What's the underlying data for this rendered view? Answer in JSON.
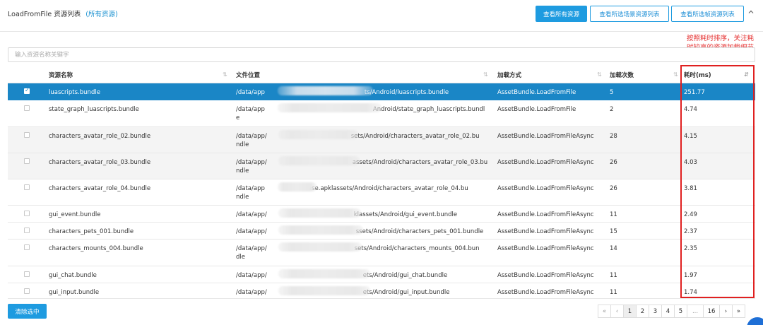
{
  "header": {
    "title": "LoadFromFile 资源列表",
    "title_link": "(所有资源)",
    "btn_all": "查看所有资源",
    "btn_scene": "查看所选场景资源列表",
    "btn_frame": "查看所选帧资源列表"
  },
  "search": {
    "placeholder": "输入资源名称关键字"
  },
  "columns": {
    "name": "资源名称",
    "path": "文件位置",
    "method": "加载方式",
    "count": "加载次数",
    "time": "耗时(ms)"
  },
  "rows": [
    {
      "name": "luascripts.bundle",
      "path_prefix": "/data/app",
      "path_suffix": "ts/Android/luascripts.bundle",
      "path_line2": "",
      "method": "AssetBundle.LoadFromFile",
      "count": "5",
      "time": "251.77"
    },
    {
      "name": "state_graph_luascripts.bundle",
      "path_prefix": "/data/app",
      "path_suffix": "Android/state_graph_luascripts.bundl",
      "path_line2": "e",
      "method": "AssetBundle.LoadFromFile",
      "count": "2",
      "time": "4.74"
    },
    {
      "name": "characters_avatar_role_02.bundle",
      "path_prefix": "/data/app/",
      "path_suffix": "sets/Android/characters_avatar_role_02.bu",
      "path_line2": "ndle",
      "method": "AssetBundle.LoadFromFileAsync",
      "count": "28",
      "time": "4.15"
    },
    {
      "name": "characters_avatar_role_03.bundle",
      "path_prefix": "/data/app/",
      "path_suffix": "assets/Android/characters_avatar_role_03.bu",
      "path_line2": "ndle",
      "method": "AssetBundle.LoadFromFileAsync",
      "count": "26",
      "time": "4.03"
    },
    {
      "name": "characters_avatar_role_04.bundle",
      "path_prefix": "/data/app",
      "path_suffix": "ase.apklassets/Android/characters_avatar_role_04.bu",
      "path_line2": "ndle",
      "method": "AssetBundle.LoadFromFileAsync",
      "count": "26",
      "time": "3.81"
    },
    {
      "name": "gui_event.bundle",
      "path_prefix": "/data/app/",
      "path_suffix": "klassets/Android/gui_event.bundle",
      "path_line2": "",
      "method": "AssetBundle.LoadFromFileAsync",
      "count": "11",
      "time": "2.49"
    },
    {
      "name": "characters_pets_001.bundle",
      "path_prefix": "/data/app/",
      "path_suffix": "ssets/Android/characters_pets_001.bundle",
      "path_line2": "",
      "method": "AssetBundle.LoadFromFileAsync",
      "count": "15",
      "time": "2.37"
    },
    {
      "name": "characters_mounts_004.bundle",
      "path_prefix": "/data/app/",
      "path_suffix": "sets/Android/characters_mounts_004.bun",
      "path_line2": "dle",
      "method": "AssetBundle.LoadFromFileAsync",
      "count": "14",
      "time": "2.35"
    },
    {
      "name": "gui_chat.bundle",
      "path_prefix": "/data/app/",
      "path_suffix": "ets/Android/gui_chat.bundle",
      "path_line2": "",
      "method": "AssetBundle.LoadFromFileAsync",
      "count": "11",
      "time": "1.97"
    },
    {
      "name": "gui_input.bundle",
      "path_prefix": "/data/app/",
      "path_suffix": "ets/Android/gui_input.bundle",
      "path_line2": "",
      "method": "AssetBundle.LoadFromFileAsync",
      "count": "11",
      "time": "1.74"
    }
  ],
  "annotation": {
    "text": "按照耗时排序，关注耗时较高的资源加载细节"
  },
  "footer": {
    "clear_label": "清除选中",
    "pager": {
      "first": "«",
      "prev": "‹",
      "pages": [
        "1",
        "2",
        "3",
        "4",
        "5"
      ],
      "ellipsis": "...",
      "last_page": "16",
      "next": "›",
      "end": "»"
    }
  },
  "colors": {
    "accent": "#1e9be0",
    "selected_row": "#1a86c6",
    "annotation": "#e02020"
  },
  "icons": {
    "collapse": "chevron-up-icon",
    "sort": "sort-icon",
    "sort_desc": "sort-desc-icon",
    "checkbox": "checkbox-icon"
  }
}
